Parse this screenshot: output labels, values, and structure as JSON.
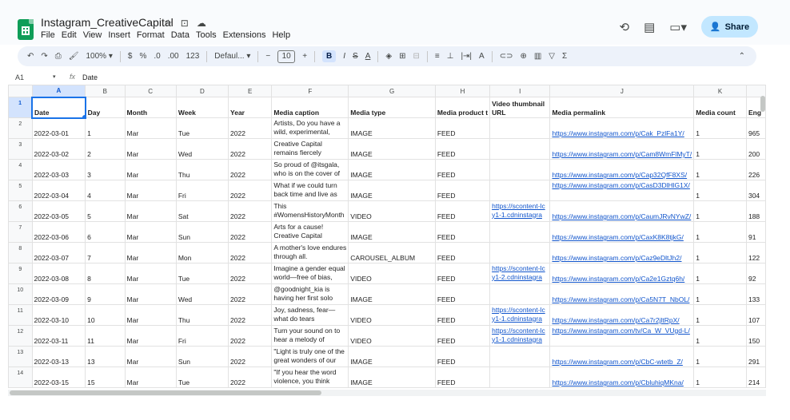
{
  "app": {
    "title": "Instagram_CreativeCapital",
    "title_icons": [
      "☆",
      "⊡",
      "☁"
    ],
    "menu": [
      "File",
      "Edit",
      "View",
      "Insert",
      "Format",
      "Data",
      "Tools",
      "Extensions",
      "Help"
    ],
    "share_label": "Share",
    "brand_color": "#0f9d58",
    "accent_color": "#c2e7ff"
  },
  "toolbar": {
    "undo": "↶",
    "redo": "↷",
    "print": "⎙",
    "paint_format": "🖌",
    "zoom": "100%",
    "currency": "$",
    "percent": "%",
    "decimal_decrease": ".0",
    "decimal_increase": ".00",
    "number_format": "123",
    "font": "Defaul...",
    "font_minus": "−",
    "font_size": "10",
    "font_plus": "+",
    "bold": "B",
    "italic": "I",
    "strike": "S",
    "text_color": "A",
    "fill": "◈",
    "borders": "⊞",
    "merge": "⊟",
    "align": "≡",
    "valign": "⊥",
    "wrap": "|⇥|",
    "rotate": "A",
    "link": "⊂⊃",
    "comment": "⊕",
    "chart": "▥",
    "filter": "▽",
    "functions": "Σ",
    "collapse": "⌃",
    "dropdown": "▾"
  },
  "formula_bar": {
    "cell_ref": "A1",
    "fx": "fx",
    "value": "Date"
  },
  "columns": [
    "A",
    "B",
    "C",
    "D",
    "E",
    "F",
    "G",
    "H",
    "I",
    "J",
    "K",
    ""
  ],
  "header_row": [
    "Date",
    "Day",
    "Month",
    "Week",
    "Year",
    "Media caption",
    "Media type",
    "Media product t",
    "Video thumbnail URL",
    "Media permalink",
    "Media count",
    "Eng"
  ],
  "rows": [
    {
      "n": "2",
      "date": "2022-03-01",
      "day": "1",
      "month": "Mar",
      "week": "Tue",
      "year": "2022",
      "caption": "Artists, Do you have a wild, experimental,",
      "type": "IMAGE",
      "product": "FEED",
      "thumb": "",
      "permalink": "https://www.instagram.com/p/Cak_PzlFa1Y/",
      "count": "1",
      "eng": "965"
    },
    {
      "n": "3",
      "date": "2022-03-02",
      "day": "2",
      "month": "Mar",
      "week": "Wed",
      "year": "2022",
      "caption": "Creative Capital remains fiercely",
      "type": "IMAGE",
      "product": "FEED",
      "thumb": "",
      "permalink": "https://www.instagram.com/p/Cam8WmFlMyT/",
      "count": "1",
      "eng": "200"
    },
    {
      "n": "4",
      "date": "2022-03-03",
      "day": "3",
      "month": "Mar",
      "week": "Thu",
      "year": "2022",
      "caption": "So proud of @itsgala, who is on the cover of",
      "type": "IMAGE",
      "product": "FEED",
      "thumb": "",
      "permalink": "https://www.instagram.com/p/Cap32QfF8XS/",
      "count": "1",
      "eng": "226"
    },
    {
      "n": "5",
      "date": "2022-03-04",
      "day": "4",
      "month": "Mar",
      "week": "Fri",
      "year": "2022",
      "caption": "What if we could turn back time and live as",
      "type": "IMAGE",
      "product": "FEED",
      "thumb": "",
      "permalink": "https://www.instagram.com/p/CasD3DlHlG1X/",
      "count": "1",
      "eng": "304"
    },
    {
      "n": "6",
      "date": "2022-03-05",
      "day": "5",
      "month": "Mar",
      "week": "Sat",
      "year": "2022",
      "caption": "This #WomensHistoryMonth",
      "type": "VIDEO",
      "product": "FEED",
      "thumb": "https://scontent-lcy1-1.cdninstagra",
      "permalink": "https://www.instagram.com/p/CaumJRvNYwZ/",
      "count": "1",
      "eng": "188"
    },
    {
      "n": "7",
      "date": "2022-03-06",
      "day": "6",
      "month": "Mar",
      "week": "Sun",
      "year": "2022",
      "caption": "Arts for a cause! Creative Capital",
      "type": "IMAGE",
      "product": "FEED",
      "thumb": "",
      "permalink": "https://www.instagram.com/p/CaxK8K8tjkG/",
      "count": "1",
      "eng": "91"
    },
    {
      "n": "8",
      "date": "2022-03-07",
      "day": "7",
      "month": "Mar",
      "week": "Mon",
      "year": "2022",
      "caption": "A mother's love endures through all.",
      "type": "CAROUSEL_ALBUM",
      "product": "FEED",
      "thumb": "",
      "permalink": "https://www.instagram.com/p/Caz9eDltJh2/",
      "count": "1",
      "eng": "122"
    },
    {
      "n": "9",
      "date": "2022-03-08",
      "day": "8",
      "month": "Mar",
      "week": "Tue",
      "year": "2022",
      "caption": "Imagine a gender equal world—free of bias,",
      "type": "VIDEO",
      "product": "FEED",
      "thumb": "https://scontent-lcy1-2.cdninstagra",
      "permalink": "https://www.instagram.com/p/Ca2e1Gztq6h/",
      "count": "1",
      "eng": "92"
    },
    {
      "n": "10",
      "date": "2022-03-09",
      "day": "9",
      "month": "Mar",
      "week": "Wed",
      "year": "2022",
      "caption": "@goodnight_kia is having her first solo",
      "type": "IMAGE",
      "product": "FEED",
      "thumb": "",
      "permalink": "https://www.instagram.com/p/Ca5N7T_NbOL/",
      "count": "1",
      "eng": "133"
    },
    {
      "n": "11",
      "date": "2022-03-10",
      "day": "10",
      "month": "Mar",
      "week": "Thu",
      "year": "2022",
      "caption": "Joy, sadness, fear—what do tears",
      "type": "VIDEO",
      "product": "FEED",
      "thumb": "https://scontent-lcy1-1.cdninstagra",
      "permalink": "https://www.instagram.com/p/Ca7r2jltRpX/",
      "count": "1",
      "eng": "107"
    },
    {
      "n": "12",
      "date": "2022-03-11",
      "day": "11",
      "month": "Mar",
      "week": "Fri",
      "year": "2022",
      "caption": "Turn your sound on to hear a melody of",
      "type": "VIDEO",
      "product": "FEED",
      "thumb": "https://scontent-lcy1-1.cdninstagra",
      "permalink": "https://www.instagram.com/tv/Ca_W_VUgd-L/",
      "count": "1",
      "eng": "150"
    },
    {
      "n": "13",
      "date": "2022-03-13",
      "day": "13",
      "month": "Mar",
      "week": "Sun",
      "year": "2022",
      "caption": "\"Light is truly one of the great wonders of our",
      "type": "IMAGE",
      "product": "FEED",
      "thumb": "",
      "permalink": "https://www.instagram.com/p/CbC-wtetb_Z/",
      "count": "1",
      "eng": "291"
    },
    {
      "n": "14",
      "date": "2022-03-15",
      "day": "15",
      "month": "Mar",
      "week": "Tue",
      "year": "2022",
      "caption": "\"If you hear the word violence, you think",
      "type": "IMAGE",
      "product": "FEED",
      "thumb": "",
      "permalink": "https://www.instagram.com/p/CbluhiqMKna/",
      "count": "1",
      "eng": "214"
    }
  ]
}
